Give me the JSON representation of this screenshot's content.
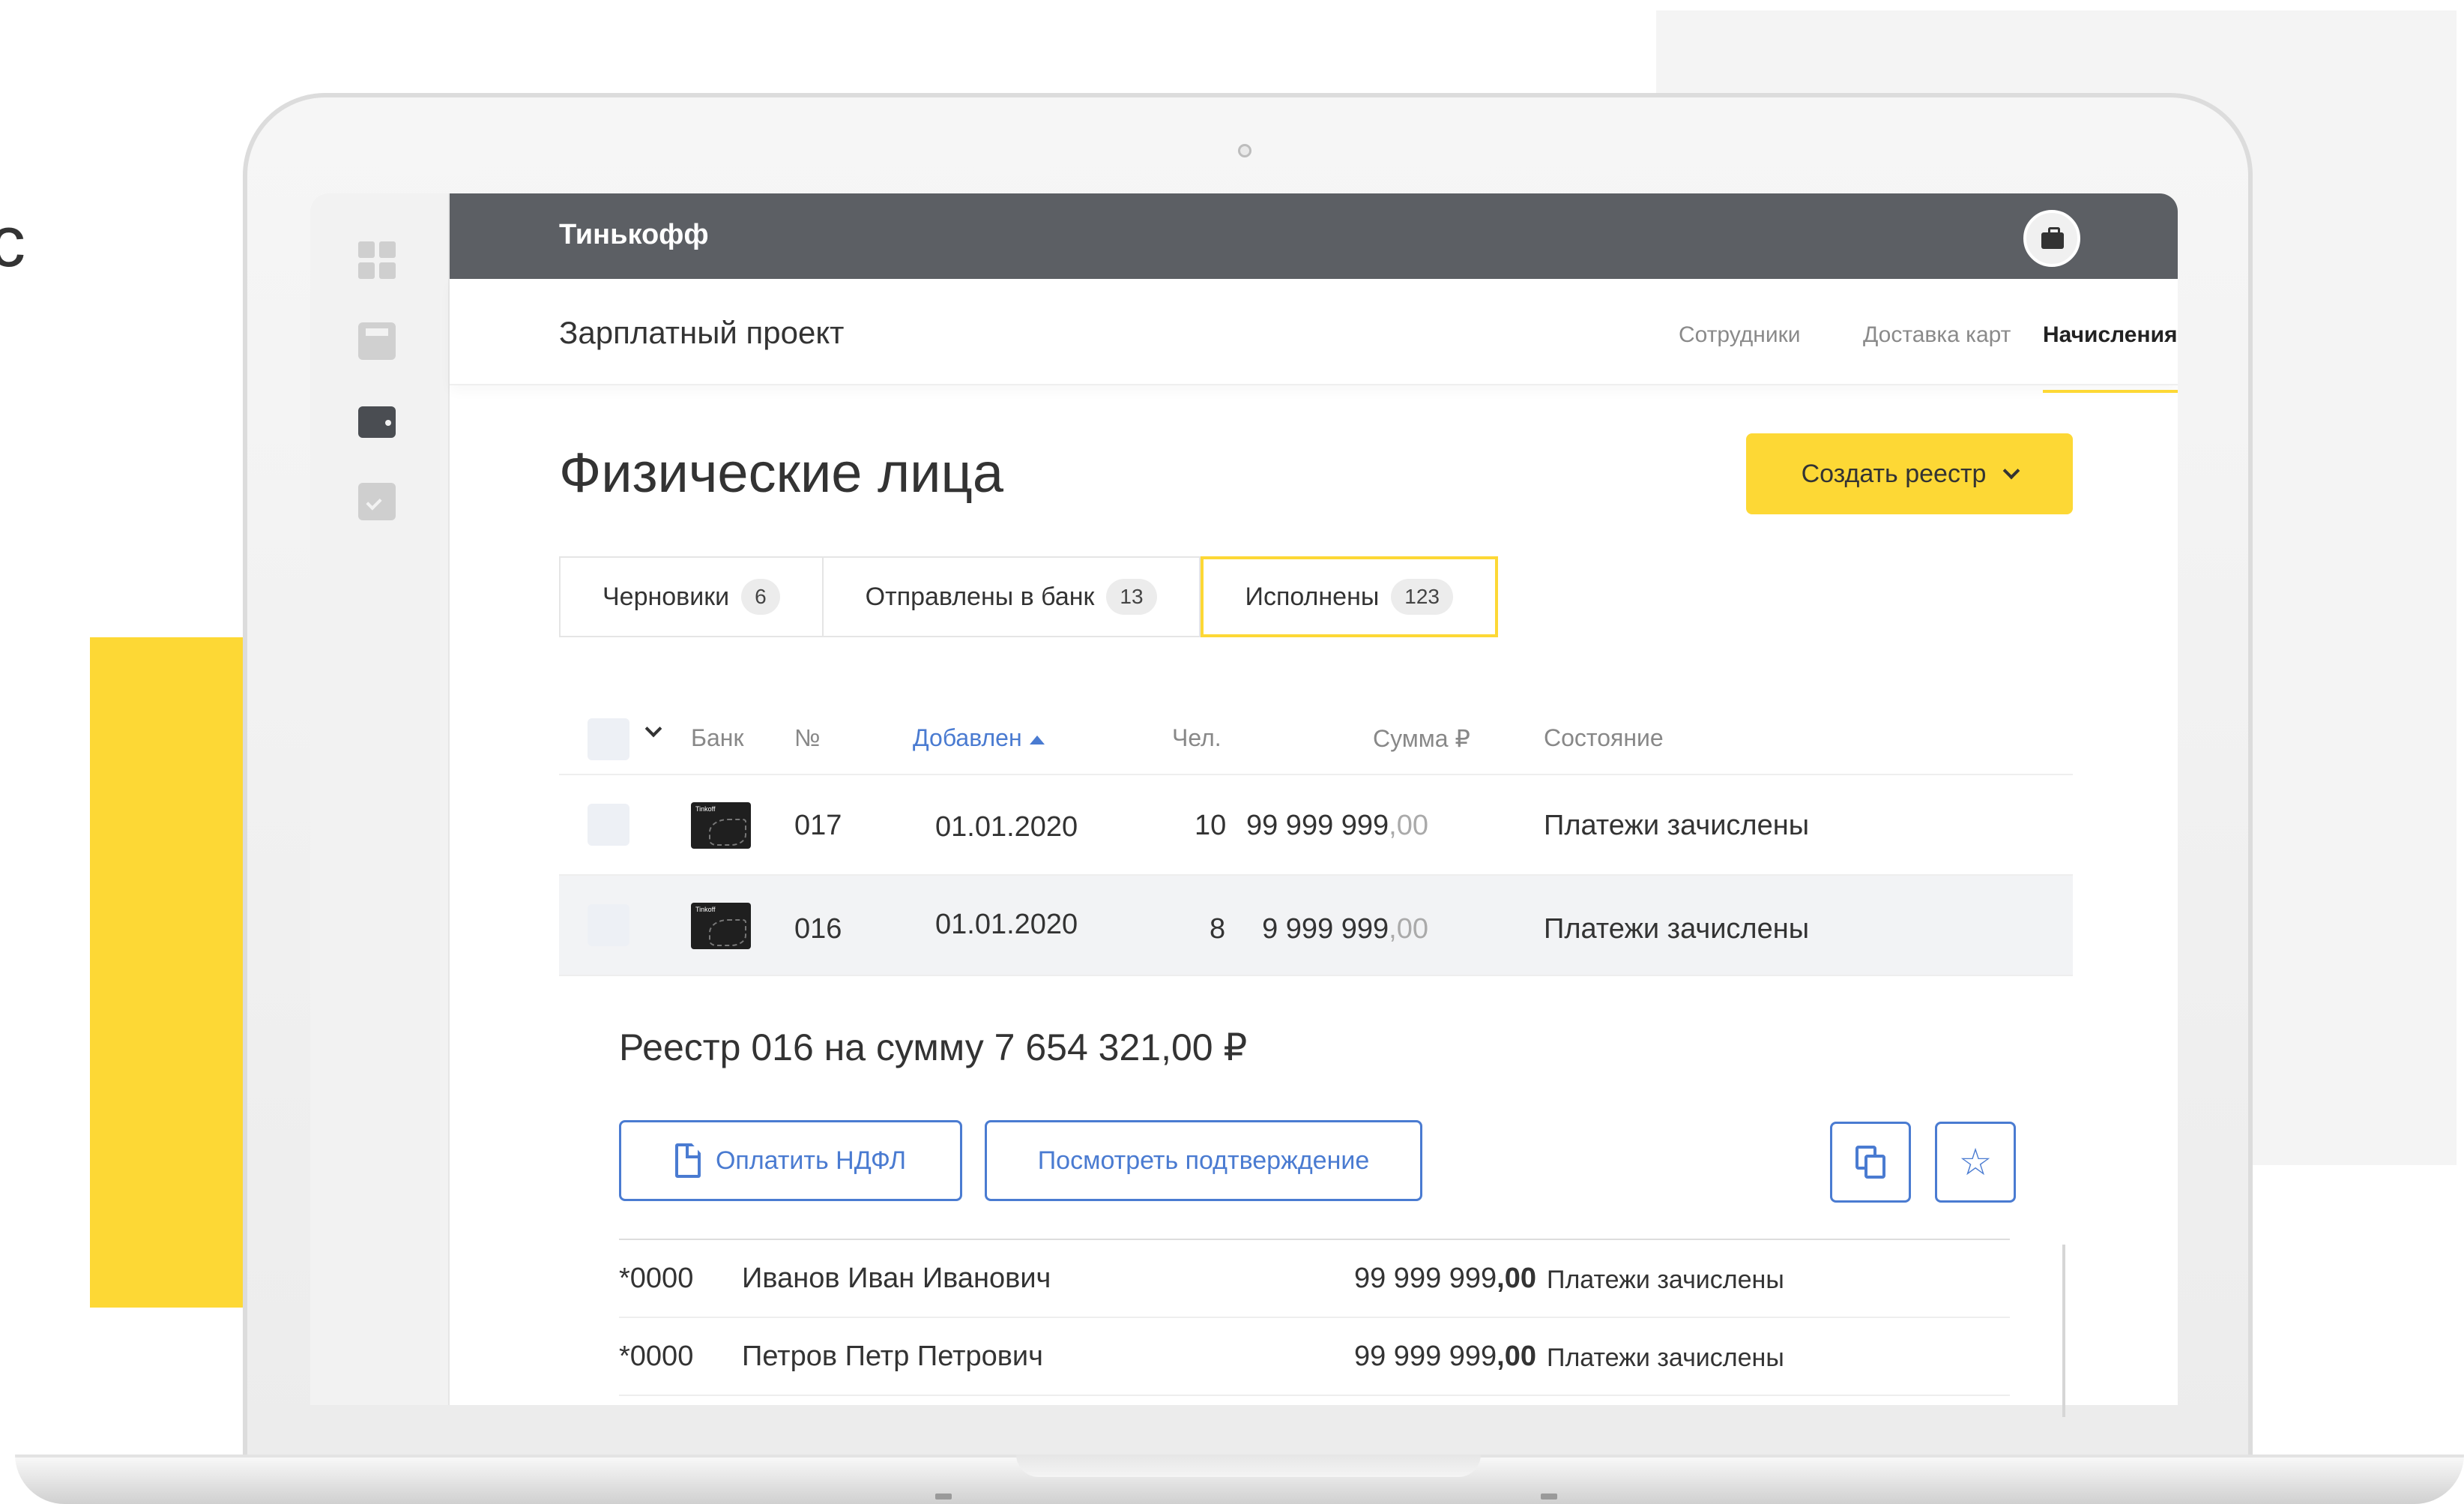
{
  "decor": {
    "glyph": "с"
  },
  "app": {
    "brand": "Тинькофф"
  },
  "subnav": {
    "title": "Зарплатный проект",
    "tabs": [
      {
        "label": "Сотрудники",
        "active": false
      },
      {
        "label": "Доставка карт",
        "active": false
      },
      {
        "label": "Начисления",
        "active": true
      }
    ]
  },
  "page": {
    "title": "Физические лица",
    "create_button": "Создать реестр"
  },
  "segments": [
    {
      "label": "Черновики",
      "count": "6"
    },
    {
      "label": "Отправлены в банк",
      "count": "13"
    },
    {
      "label": "Исполнены",
      "count": "123",
      "active": true
    }
  ],
  "table": {
    "headers": {
      "bank": "Банк",
      "number": "№",
      "added": "Добавлен",
      "people": "Чел.",
      "sum": "Сумма ₽",
      "status": "Состояние"
    },
    "rows": [
      {
        "number": "017",
        "date": "01.01.2020",
        "people": "10",
        "sum_int": "99 999 999",
        "sum_frac": ",00",
        "status": "Платежи зачислены"
      },
      {
        "number": "016",
        "date": "01.01.2020",
        "people": "8",
        "sum_int": "9 999 999",
        "sum_frac": ",00",
        "status": "Платежи зачислены"
      }
    ]
  },
  "detail": {
    "title": "Реестр 016 на сумму 7 654 321,00 ₽",
    "pay_button": "Оплатить НДФЛ",
    "view_button": "Посмотреть подтверждение",
    "employees": [
      {
        "account": "*0000",
        "name": "Иванов Иван Иванович",
        "sum_int": "99 999 999",
        "sum_frac": ",00",
        "status": "Платежи зачислены"
      },
      {
        "account": "*0000",
        "name": "Петров Петр Петрович",
        "sum_int": "99 999 999",
        "sum_frac": ",00",
        "status": "Платежи зачислены"
      }
    ]
  },
  "colors": {
    "accent_yellow": "#fdd835",
    "link_blue": "#4a7bd1",
    "topbar": "#5c5f64"
  },
  "icons": [
    "dashboard-icon",
    "calculator-icon",
    "wallet-icon",
    "calendar-check-icon",
    "briefcase-icon",
    "document-icon",
    "copy-icon",
    "star-icon",
    "chevron-down-icon",
    "sort-up-icon"
  ]
}
